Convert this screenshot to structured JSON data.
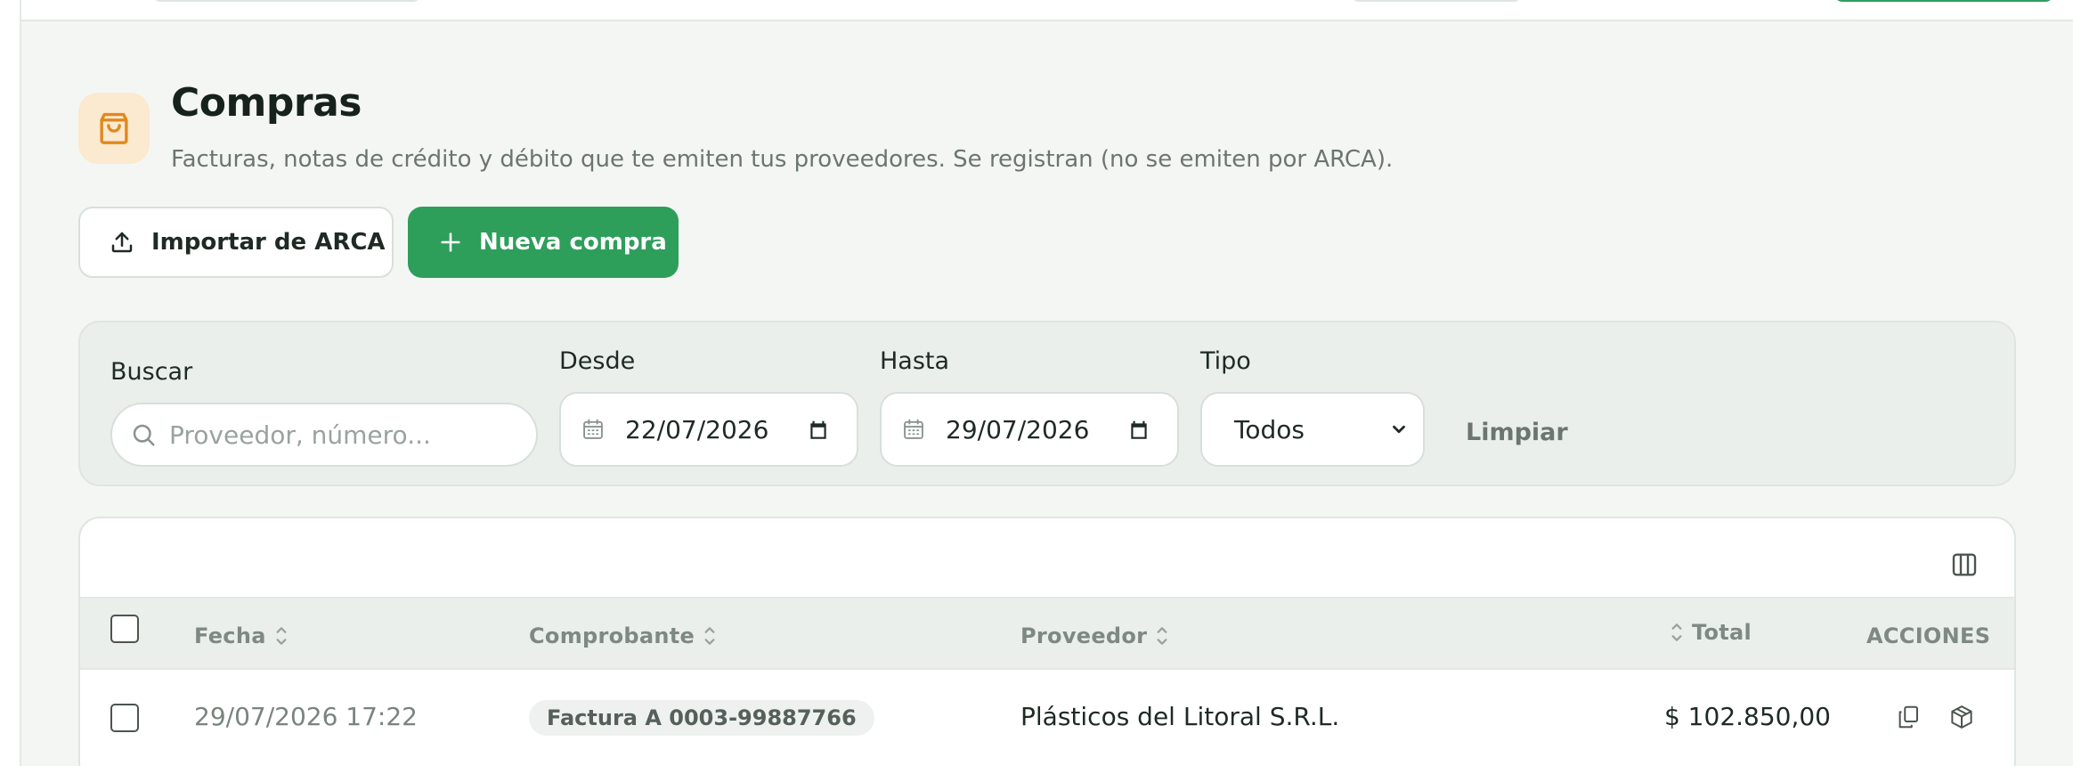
{
  "page": {
    "title": "Compras",
    "subtitle": "Facturas, notas de crédito y débito que te emiten tus proveedores. Se registran (no se emiten por ARCA).",
    "header_icon": "shopping-bag-icon"
  },
  "actions": {
    "import_label": "Importar de ARCA",
    "new_label": "Nueva compra"
  },
  "filters": {
    "search_label": "Buscar",
    "search_placeholder": "Proveedor, número...",
    "from_label": "Desde",
    "from_value": "22/07/2026",
    "to_label": "Hasta",
    "to_value": "29/07/2026",
    "type_label": "Tipo",
    "type_value": "Todos",
    "clear_label": "Limpiar"
  },
  "table": {
    "columns": [
      "Fecha",
      "Comprobante",
      "Proveedor",
      "Total",
      "ACCIONES"
    ],
    "rows": [
      {
        "date": "29/07/2026 17:22",
        "voucher": "Factura A 0003-99887766",
        "supplier": "Plásticos del Litoral S.R.L.",
        "total": "$ 102.850,00"
      }
    ]
  },
  "colors": {
    "accent": "#2e9e5b",
    "icon_bg": "#fbe9d0",
    "icon_fg": "#e0891f"
  }
}
